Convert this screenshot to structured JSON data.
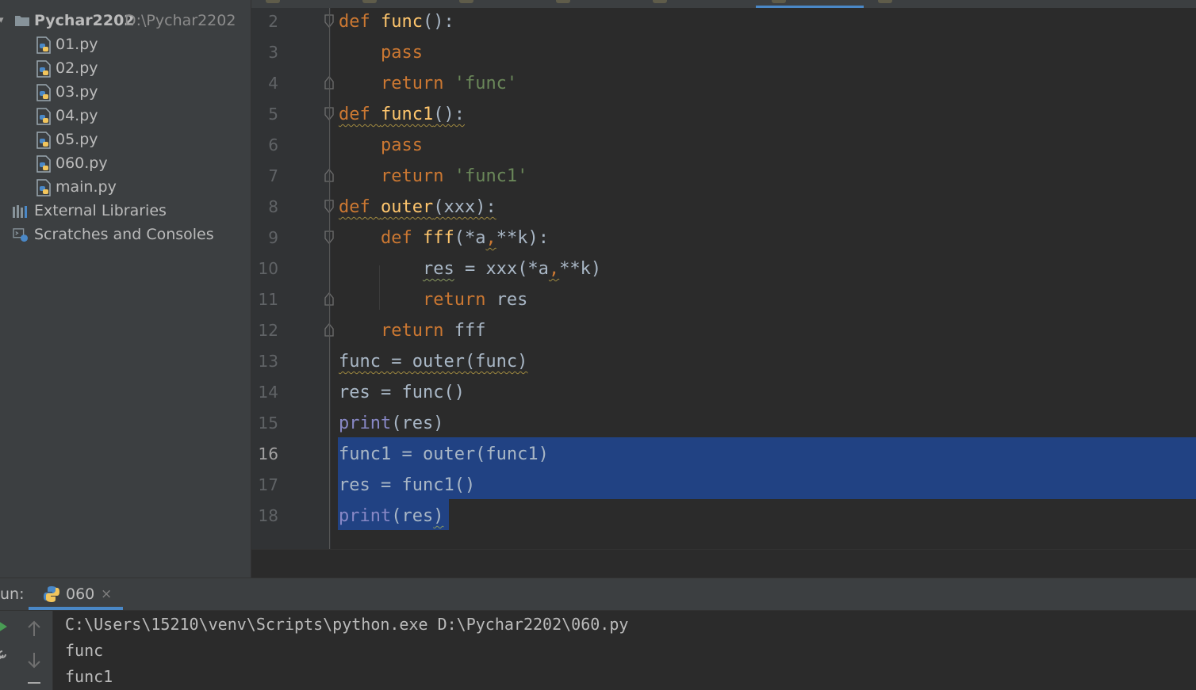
{
  "project": {
    "root_name": "Pychar2202",
    "root_path": "D:\\Pychar2202",
    "files": [
      "01.py",
      "02.py",
      "03.py",
      "04.py",
      "05.py",
      "060.py",
      "main.py"
    ],
    "external_libraries": "External Libraries",
    "scratches": "Scratches and Consoles"
  },
  "editor": {
    "current_line": 16,
    "line_numbers": [
      "2",
      "3",
      "4",
      "5",
      "6",
      "7",
      "8",
      "9",
      "10",
      "11",
      "12",
      "13",
      "14",
      "15",
      "16",
      "17",
      "18"
    ]
  },
  "run": {
    "label": "un:",
    "tab_name": "060",
    "close_glyph": "×",
    "output": [
      "C:\\Users\\15210\\venv\\Scripts\\python.exe D:\\Pychar2202\\060.py",
      "func",
      "func1"
    ]
  },
  "colors": {
    "keyword": "#cc7832",
    "function": "#ffc66d",
    "string": "#6a8759",
    "builtin": "#8888c6",
    "selection": "#214283",
    "accent": "#4a88c7"
  }
}
